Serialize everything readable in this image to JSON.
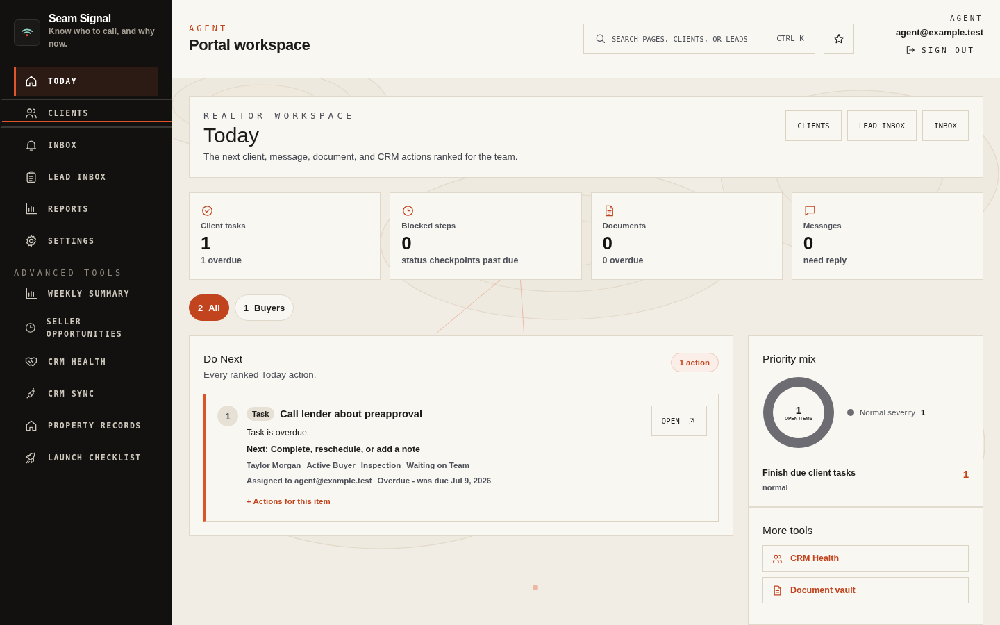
{
  "brand": {
    "name": "Seam Signal",
    "tagline": "Know who to call, and why now."
  },
  "nav": [
    {
      "label": "TODAY",
      "selected": true,
      "hovered": false
    },
    {
      "label": "CLIENTS",
      "selected": false,
      "hovered": true
    },
    {
      "label": "INBOX",
      "selected": false,
      "hovered": false
    },
    {
      "label": "LEAD INBOX",
      "selected": false,
      "hovered": false
    },
    {
      "label": "REPORTS",
      "selected": false,
      "hovered": false
    },
    {
      "label": "SETTINGS",
      "selected": false,
      "hovered": false
    }
  ],
  "advanced": {
    "heading": "ADVANCED TOOLS",
    "items": [
      {
        "label": "WEEKLY SUMMARY",
        "selected": false
      },
      {
        "label": "SELLER OPPORTUNITIES",
        "selected": false
      },
      {
        "label": "CRM HEALTH",
        "selected": false
      },
      {
        "label": "CRM SYNC",
        "selected": false
      },
      {
        "label": "PROPERTY RECORDS",
        "selected": false
      },
      {
        "label": "LAUNCH CHECKLIST",
        "selected": false
      }
    ]
  },
  "header": {
    "eyebrow": "AGENT",
    "title": "Portal workspace",
    "search": {
      "placeholder": "SEARCH PAGES, CLIENTS, OR LEADS",
      "shortcut": "CTRL K"
    },
    "role": "AGENT",
    "email": "agent@example.test",
    "sign_out": "SIGN OUT"
  },
  "hero": {
    "eyebrow": "REALTOR WORKSPACE",
    "title": "Today",
    "subtitle": "The next client, message, document, and CRM actions ranked for the team.",
    "buttons": [
      "CLIENTS",
      "LEAD INBOX",
      "INBOX"
    ]
  },
  "stats": [
    {
      "label": "Client tasks",
      "value": "1",
      "detail": "1 overdue"
    },
    {
      "label": "Blocked steps",
      "value": "0",
      "detail": "status checkpoints past due"
    },
    {
      "label": "Documents",
      "value": "0",
      "detail": "0 overdue"
    },
    {
      "label": "Messages",
      "value": "0",
      "detail": "need reply"
    }
  ],
  "filters": [
    {
      "count": "2",
      "label": "All",
      "selected": true
    },
    {
      "count": "1",
      "label": "Buyers",
      "selected": false
    }
  ],
  "do_next": {
    "title": "Do Next",
    "subtitle": "Every ranked Today action.",
    "badge": "1 action",
    "items": [
      {
        "rank": "1",
        "tag": "Task",
        "title": "Call lender about preapproval",
        "description": "Task is overdue.",
        "next": "Next: Complete, reschedule, or add a note",
        "meta": [
          "Taylor Morgan",
          "Active Buyer",
          "Inspection",
          "Waiting on Team"
        ],
        "meta_2": [
          "Assigned to agent@example.test",
          "Overdue - was due Jul 9, 2026"
        ],
        "actions": "+ Actions for this item",
        "open": "OPEN"
      }
    ]
  },
  "priority": {
    "title": "Priority mix",
    "center_value": "1",
    "center_label": "OPEN ITEMS",
    "segments": [
      {
        "label": "Normal severity",
        "value": "1",
        "color": "#6d6c72"
      }
    ],
    "focus": {
      "title": "Finish due client tasks",
      "level_text": "normal",
      "count": "1"
    }
  },
  "more_tools": {
    "title": "More tools",
    "links": [
      "CRM Health",
      "Document vault"
    ]
  }
}
